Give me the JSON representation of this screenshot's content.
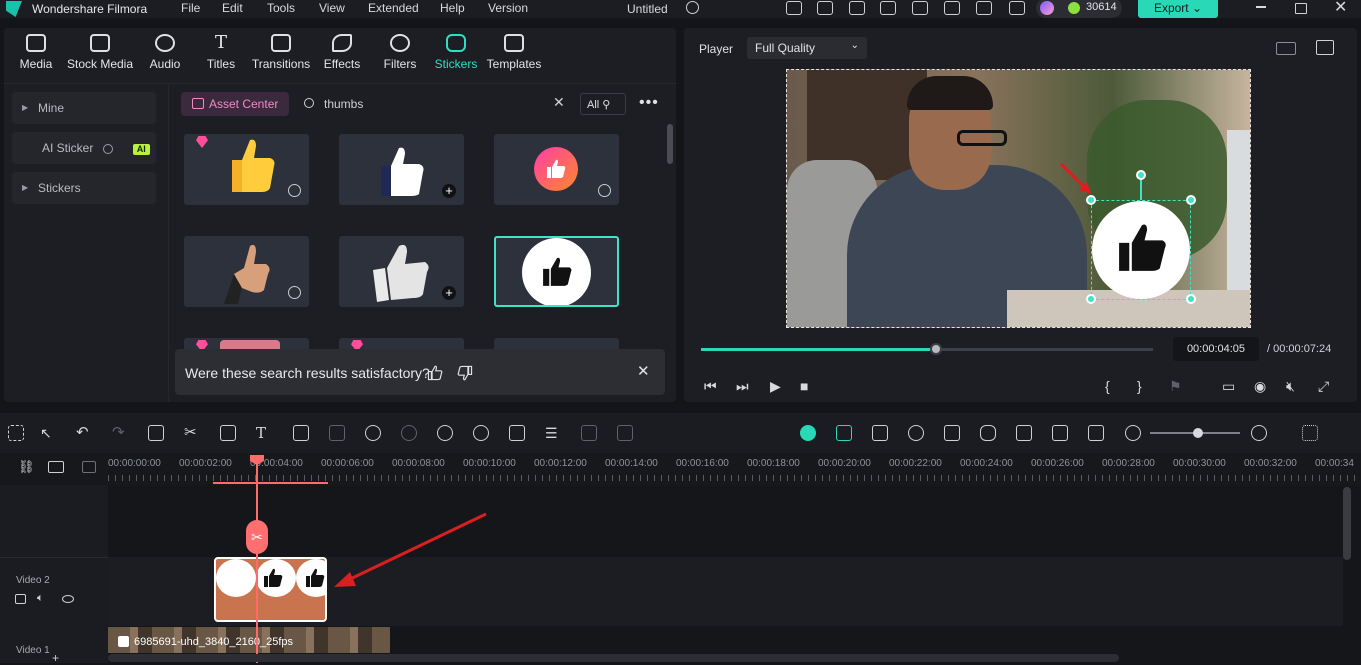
{
  "app": {
    "name": "Wondershare Filmora",
    "menu": [
      "File",
      "Edit",
      "Tools",
      "View",
      "Extended",
      "Help",
      "Version"
    ],
    "doc_title": "Untitled",
    "credits": "30614",
    "export_label": "Export"
  },
  "tabs": [
    "Media",
    "Stock Media",
    "Audio",
    "Titles",
    "Transitions",
    "Effects",
    "Filters",
    "Stickers",
    "Templates"
  ],
  "active_tab": "Stickers",
  "sidebar": {
    "items": [
      {
        "label": "Mine"
      },
      {
        "label": "AI Sticker",
        "badge": "AI"
      },
      {
        "label": "Stickers"
      }
    ]
  },
  "browser": {
    "asset_center": "Asset Center",
    "search_value": "thumbs",
    "filter_label": "All"
  },
  "feedback": {
    "question": "Were these search results satisfactory?"
  },
  "player": {
    "label": "Player",
    "quality": "Full Quality",
    "current_time": "00:00:04:05",
    "total_time": "/ 00:00:07:24",
    "progress": 0.52
  },
  "timeline": {
    "ruler": [
      "00:00:00:00",
      "00:00:02:00",
      "00:00:04:00",
      "00:00:06:00",
      "00:00:08:00",
      "00:00:10:00",
      "00:00:12:00",
      "00:00:14:00",
      "00:00:16:00",
      "00:00:18:00",
      "00:00:20:00",
      "00:00:22:00",
      "00:00:24:00",
      "00:00:26:00",
      "00:00:28:00",
      "00:00:30:00",
      "00:00:32:00",
      "00:00:34"
    ],
    "tracks": [
      {
        "label": "Video 2"
      },
      {
        "label": "Video 1"
      }
    ],
    "video_clip_name": "6985691-uhd_3840_2160_25fps"
  },
  "colors": {
    "accent": "#28d8b7",
    "playhead": "#ff6a6a",
    "sticker_clip": "#c9734f"
  }
}
